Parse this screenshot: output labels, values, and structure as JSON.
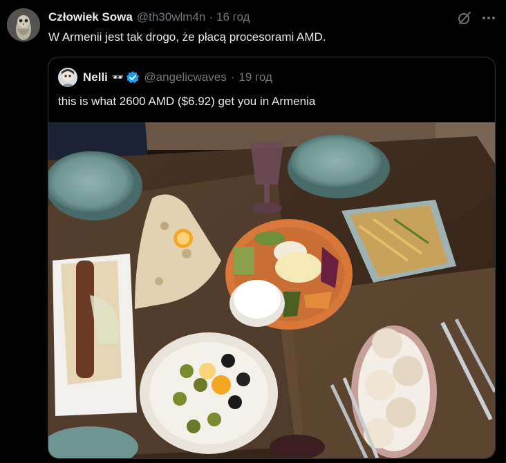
{
  "tweet": {
    "author_name": "Człowiek Sowa",
    "handle": "@th30wlm4n",
    "separator": "·",
    "time": "16 год",
    "text": "W Armenii jest tak drogo, że płacą procesorami AMD."
  },
  "icons": {
    "grok": "grok-icon",
    "more": "more-icon",
    "verified": "verified-badge-icon"
  },
  "quoted_tweet": {
    "author_name": "Nelli",
    "name_glyphs": "🕶",
    "handle": "@angelicwaves",
    "separator": "·",
    "time": "19 год",
    "text": "this is what 2600 AMD ($6.92) get you in Armenia"
  },
  "colors": {
    "background": "#000000",
    "text_primary": "#e7e9ea",
    "text_secondary": "#71767b",
    "verified": "#1d9bf0",
    "border": "#2f3336"
  }
}
